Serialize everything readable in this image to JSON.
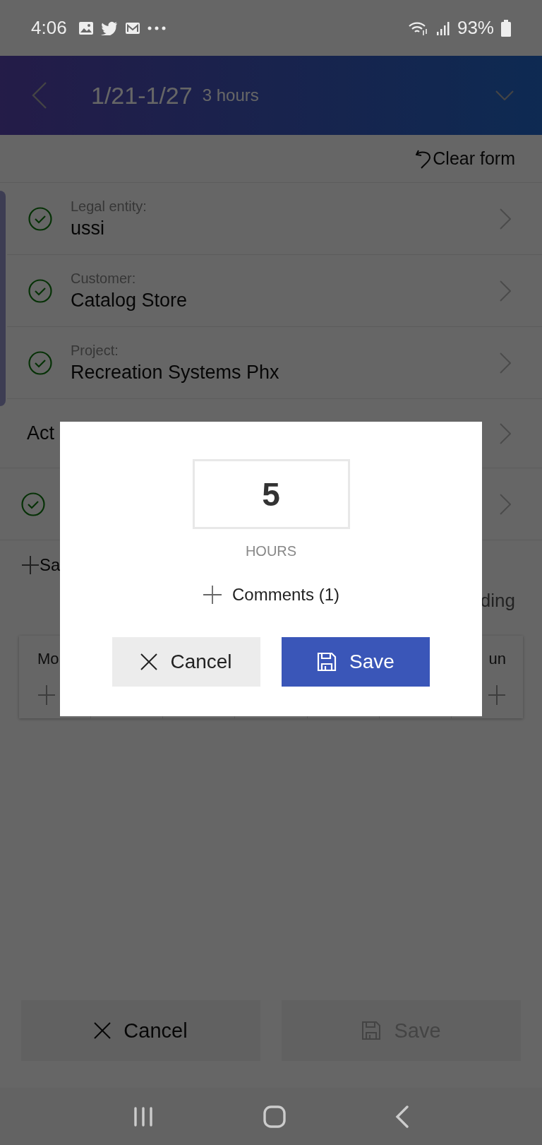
{
  "status_bar": {
    "time": "4:06",
    "battery": "93%"
  },
  "header": {
    "title": "1/21-1/27",
    "subtitle": "3 hours"
  },
  "clear_form": "Clear form",
  "rows": [
    {
      "kind": "field",
      "complete": true,
      "label": "Legal entity:",
      "value": "ussi"
    },
    {
      "kind": "field",
      "complete": true,
      "label": "Customer:",
      "value": "Catalog Store"
    },
    {
      "kind": "field",
      "complete": true,
      "label": "Project:",
      "value": "Recreation Systems Phx"
    },
    {
      "kind": "heading",
      "complete": false,
      "value": "Act"
    },
    {
      "kind": "field",
      "complete": true
    }
  ],
  "save_link": "Sa",
  "right_note": "ding",
  "week": {
    "first_day": "Mo",
    "last_day": "un"
  },
  "footer_buttons": [
    {
      "kind": "cancel",
      "label": "Cancel",
      "disabled": false
    },
    {
      "kind": "save",
      "label": "Save",
      "disabled": true
    }
  ],
  "dialog": {
    "value": "5",
    "unit": "HOURS",
    "comments": "Comments (1)",
    "buttons": [
      {
        "kind": "cancel",
        "label": "Cancel"
      },
      {
        "kind": "save",
        "label": "Save"
      }
    ]
  }
}
